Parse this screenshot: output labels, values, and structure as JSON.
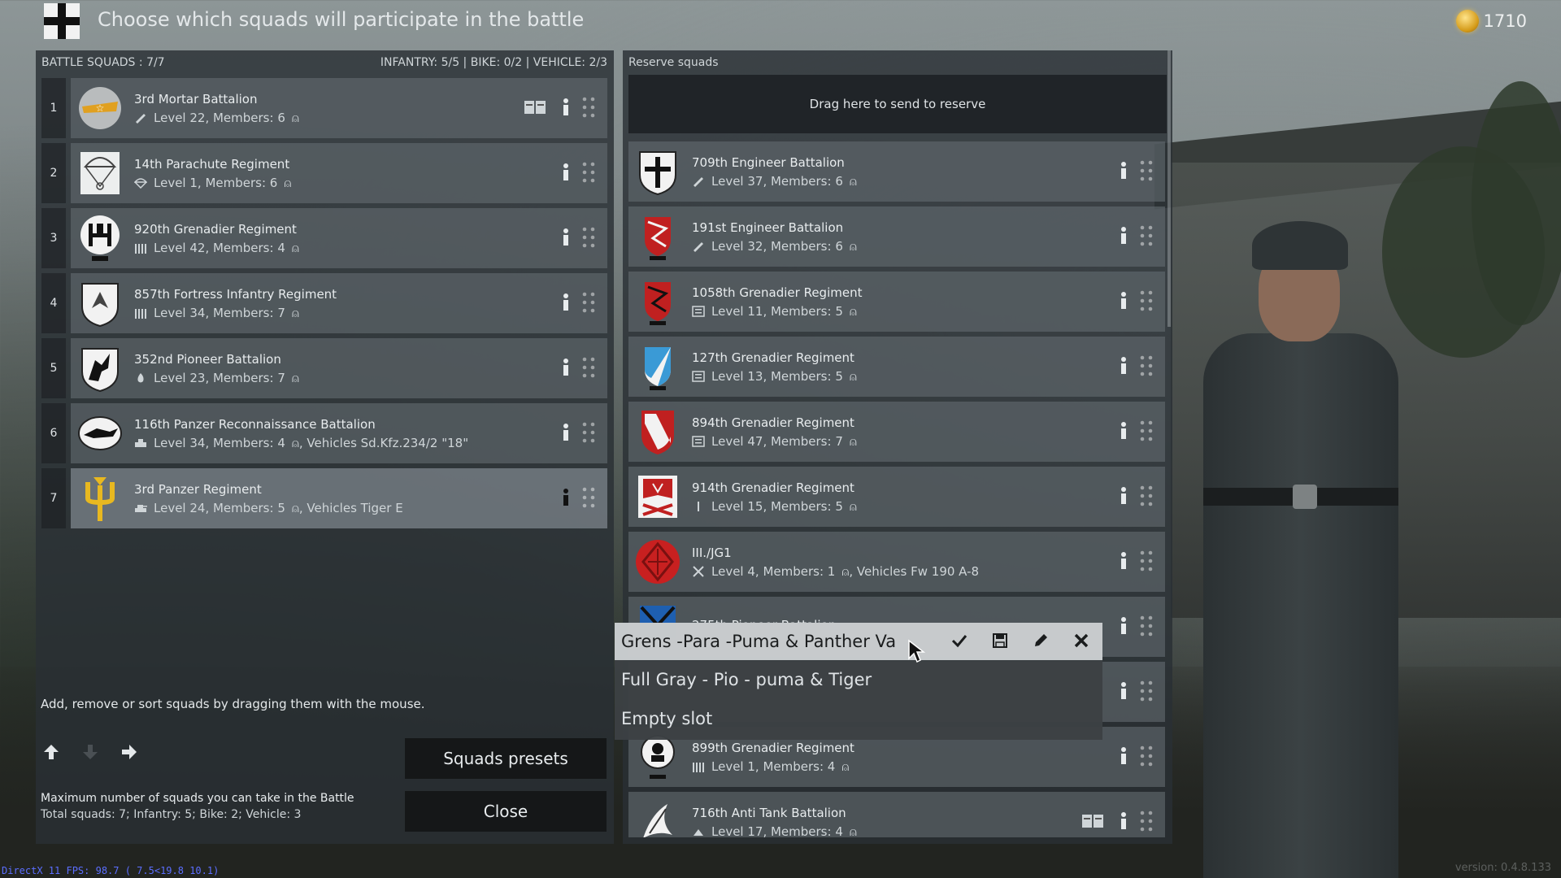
{
  "header": {
    "title": "Choose which squads will participate in the battle",
    "coins": "1710"
  },
  "battle": {
    "header_left": "BATTLE SQUADS : 7/7",
    "header_right": "INFANTRY: 5/5 | BIKE: 0/2 | VEHICLE: 2/3",
    "squads": [
      {
        "num": "1",
        "name": "3rd  Mortar Battalion",
        "meta": "Level 22, Members: 6",
        "vehicles": ""
      },
      {
        "num": "2",
        "name": "14th Parachute Regiment",
        "meta": "Level 1, Members: 6",
        "vehicles": ""
      },
      {
        "num": "3",
        "name": "920th Grenadier Regiment",
        "meta": "Level 42, Members: 4",
        "vehicles": ""
      },
      {
        "num": "4",
        "name": "857th Fortress Infantry Regiment",
        "meta": "Level 34, Members: 7",
        "vehicles": ""
      },
      {
        "num": "5",
        "name": "352nd Pioneer Battalion",
        "meta": "Level 23, Members: 7",
        "vehicles": ""
      },
      {
        "num": "6",
        "name": "116th Panzer Reconnaissance Battalion",
        "meta": "Level 34, Members: 4",
        "vehicles": ", Vehicles Sd.Kfz.234/2 \"18\""
      },
      {
        "num": "7",
        "name": "3rd Panzer Regiment",
        "meta": "Level 24, Members: 5",
        "vehicles": ", Vehicles Tiger E"
      }
    ],
    "help_text": "Add, remove or sort squads by dragging them with the mouse.",
    "max_title": "Maximum number of squads you can take in the Battle",
    "max_line": "Total squads: 7; Infantry: 5; Bike: 2; Vehicle: 3",
    "presets_button": "Squads presets",
    "close_button": "Close"
  },
  "reserve": {
    "header": "Reserve squads",
    "drop_zone": "Drag here to send to reserve",
    "squads": [
      {
        "name": "709th Engineer Battalion",
        "meta": "Level 37, Members: 6",
        "vehicles": ""
      },
      {
        "name": "191st Engineer Battalion",
        "meta": "Level 32, Members: 6",
        "vehicles": ""
      },
      {
        "name": "1058th Grenadier Regiment",
        "meta": "Level 11, Members: 5",
        "vehicles": ""
      },
      {
        "name": "127th Grenadier Regiment",
        "meta": "Level 13, Members: 5",
        "vehicles": ""
      },
      {
        "name": "894th Grenadier Regiment",
        "meta": "Level 47, Members: 7",
        "vehicles": ""
      },
      {
        "name": "914th Grenadier Regiment",
        "meta": "Level 15, Members: 5",
        "vehicles": ""
      },
      {
        "name": "III./JG1",
        "meta": "Level 4, Members: 1",
        "vehicles": ", Vehicles Fw 190 A-8"
      },
      {
        "name": "275th Pioneer Battalion",
        "meta": "",
        "vehicles": ""
      },
      {
        "name": "",
        "meta": "",
        "vehicles": ""
      },
      {
        "name": "899th Grenadier Regiment",
        "meta": "Level 1, Members: 4",
        "vehicles": ""
      },
      {
        "name": "716th Anti Tank Battalion",
        "meta": "Level 17, Members: 4",
        "vehicles": ""
      }
    ]
  },
  "presets": {
    "items": [
      "Grens -Para -Puma & Panther Va",
      "Full Gray - Pio - puma & Tiger",
      "Empty slot"
    ]
  },
  "footer": {
    "fps": "DirectX 11 FPS: 98.7 ( 7.5<19.8 10.1)",
    "version": "version: 0.4.8.133"
  },
  "colors": {
    "accent_yellow": "#e8b820",
    "panel_bg": "#2a3034",
    "row_bg": "#626a70"
  }
}
